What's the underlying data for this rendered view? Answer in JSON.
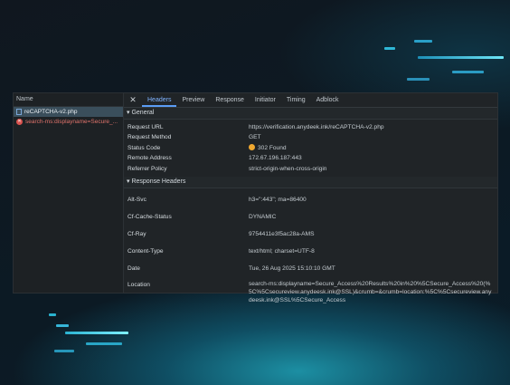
{
  "left_panel": {
    "header": "Name",
    "rows": [
      {
        "label": "reCAPTCHA-v2.php",
        "icon": "document-icon",
        "selected": true
      },
      {
        "label": "search-ms:displayname=Secure_...",
        "icon": "error-icon",
        "selected": false
      }
    ]
  },
  "tabs": {
    "close": "✕",
    "items": [
      "Headers",
      "Preview",
      "Response",
      "Initiator",
      "Timing",
      "Adblock"
    ],
    "active": "Headers"
  },
  "general": {
    "title": "▾ General",
    "rows": [
      {
        "key": "Request URL",
        "value": "https://verification.anydeek.ink/reCAPTCHA-v2.php"
      },
      {
        "key": "Request Method",
        "value": "GET"
      },
      {
        "key": "Status Code",
        "value": "302 Found"
      },
      {
        "key": "Remote Address",
        "value": "172.67.196.187:443"
      },
      {
        "key": "Referrer Policy",
        "value": "strict-origin-when-cross-origin"
      }
    ]
  },
  "response_headers": {
    "title": "▾ Response Headers",
    "rows": [
      {
        "key": "Alt-Svc",
        "value": "h3=\":443\"; ma=86400"
      },
      {
        "key": "Cf-Cache-Status",
        "value": "DYNAMIC"
      },
      {
        "key": "Cf-Ray",
        "value": "9754411e3f5ac28a-AMS"
      },
      {
        "key": "Content-Type",
        "value": "text/html; charset=UTF-8"
      },
      {
        "key": "Date",
        "value": "Tue, 26 Aug 2025 15:10:10 GMT"
      },
      {
        "key": "Location",
        "value": "search-ms:displayname=Secure_Access%20Results%20in%20%5CSecure_Access%20(%5C%5Csecureview.anydeesk.ink@SSL)&crumb=&crumb=location:%5C%5Csecureview.anydeesk.ink@SSL%5CSecure_Access"
      }
    ]
  },
  "colors": {
    "accent": "#5b9cf5",
    "status_dot": "#f0a830",
    "error": "#d9534f"
  }
}
